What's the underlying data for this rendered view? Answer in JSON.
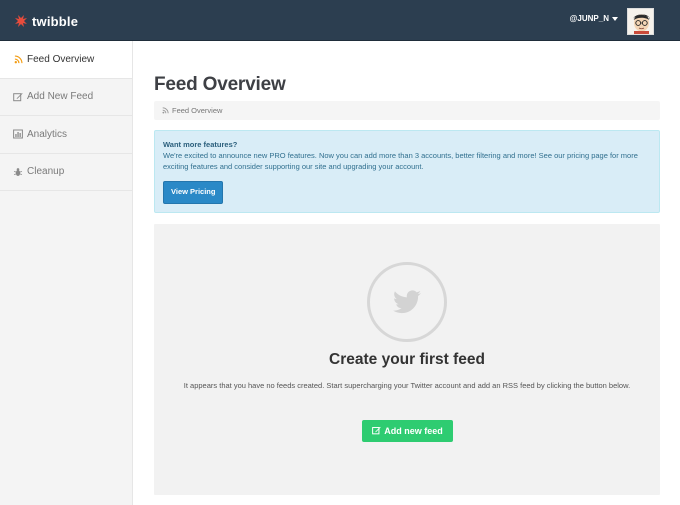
{
  "topbar": {
    "brand": "twibble",
    "user_label": "@JUNP_N",
    "brand_color": "#e74c3c",
    "bar_color": "#2c3e50"
  },
  "sidebar": {
    "items": [
      {
        "label": "Feed Overview",
        "icon": "rss-icon",
        "active": true
      },
      {
        "label": "Add New Feed",
        "icon": "edit-icon",
        "active": false
      },
      {
        "label": "Analytics",
        "icon": "bar-chart-icon",
        "active": false
      },
      {
        "label": "Cleanup",
        "icon": "bug-icon",
        "active": false
      }
    ]
  },
  "main": {
    "title": "Feed Overview",
    "breadcrumb": "Feed Overview",
    "alert": {
      "title": "Want more features?",
      "body": "We're excited to announce new PRO features. Now you can add more than 3 accounts, better filtering and more! See our pricing page for more exciting features and consider supporting our site and upgrading your account.",
      "button": "View Pricing"
    },
    "empty": {
      "icon": "twitter-bird-icon",
      "title": "Create your first feed",
      "text": "It appears that you have no feeds created. Start supercharging your Twitter account and add an RSS feed by clicking the button below.",
      "button": "Add new feed",
      "button_color": "#2ecc71"
    }
  }
}
